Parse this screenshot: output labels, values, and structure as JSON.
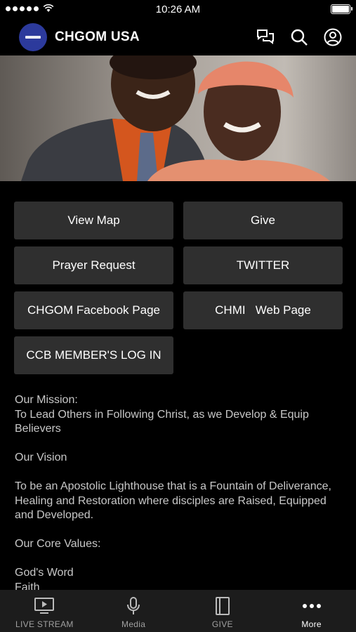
{
  "status_bar": {
    "time": "10:26 AM",
    "battery_level": 1.0
  },
  "header": {
    "title": "CHGOM USA"
  },
  "buttons": [
    {
      "label": "View Map"
    },
    {
      "label": "Give"
    },
    {
      "label": "Prayer Request"
    },
    {
      "label": "TWITTER"
    },
    {
      "label": "CHGOM Facebook Page"
    },
    {
      "label": "CHMI   Web Page"
    },
    {
      "label": "CCB MEMBER'S LOG IN"
    }
  ],
  "content": {
    "mission_heading": "Our Mission:",
    "mission_text": "To Lead Others in Following Christ, as we Develop & Equip Believers",
    "vision_heading": "Our Vision",
    "vision_text": "To be an Apostolic Lighthouse that is a Fountain of Deliverance, Healing and Restoration where disciples are Raised, Equipped and Developed.",
    "values_heading": "Our Core Values:",
    "values": [
      "God's Word",
      "Faith"
    ]
  },
  "tabs": [
    {
      "label": "LIVE STREAM",
      "icon": "tv-play-icon",
      "active": false
    },
    {
      "label": "Media",
      "icon": "microphone-icon",
      "active": false
    },
    {
      "label": "GIVE",
      "icon": "book-icon",
      "active": false
    },
    {
      "label": "More",
      "icon": "more-dots-icon",
      "active": true
    }
  ],
  "colors": {
    "background": "#000000",
    "button": "#2f2f2f",
    "tab_bar": "#1c1c1c",
    "logo": "#2c3a9c"
  }
}
